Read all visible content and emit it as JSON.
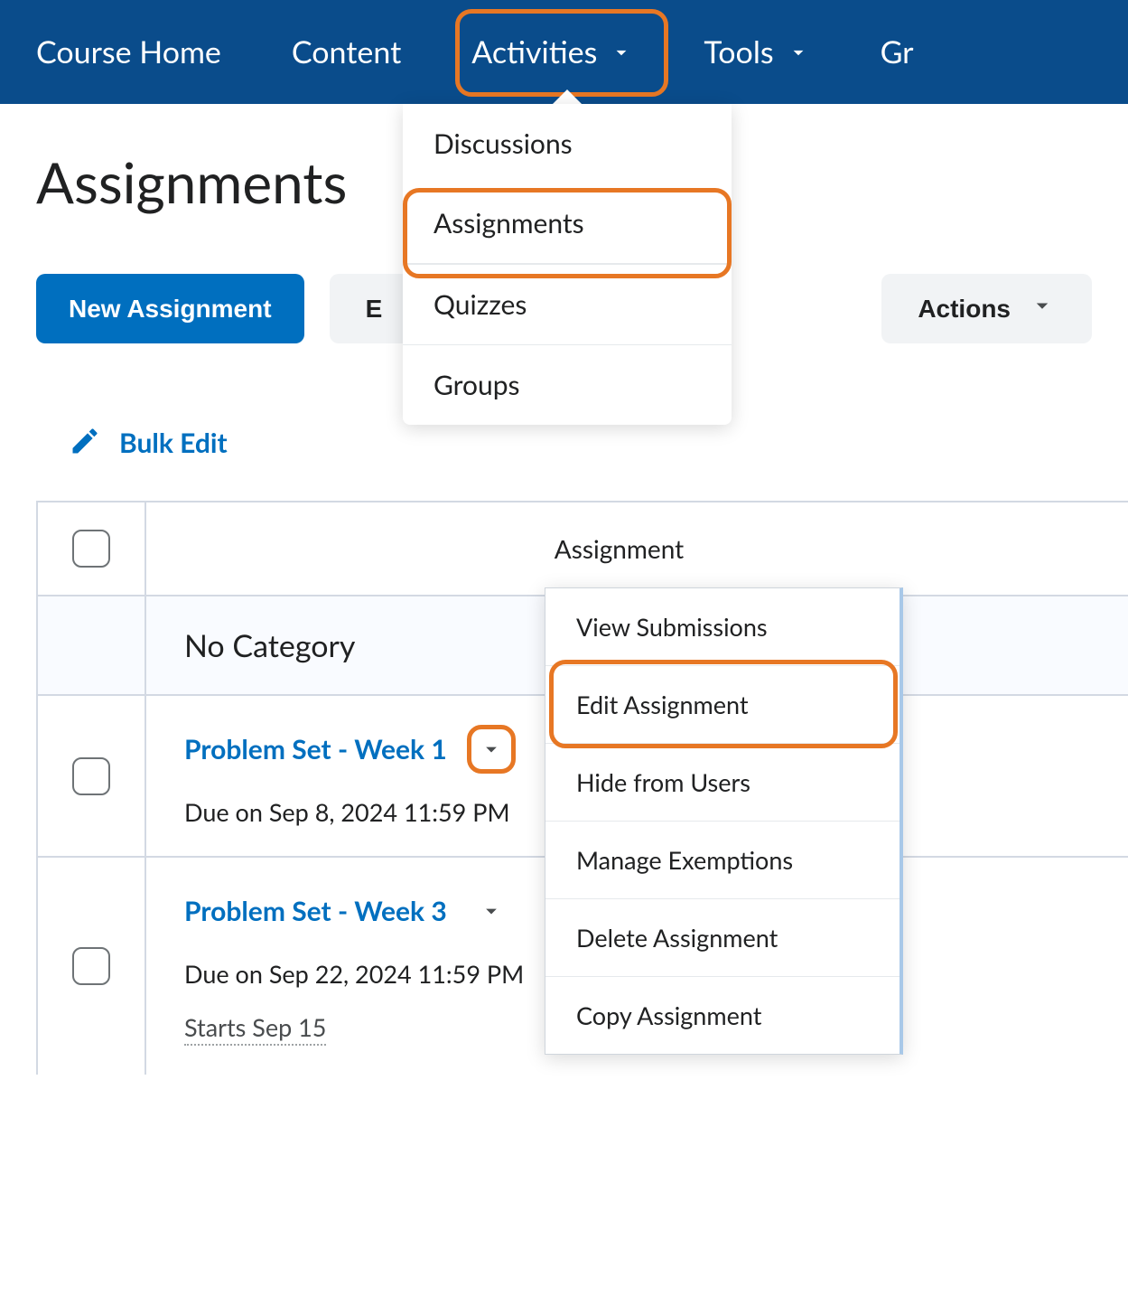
{
  "nav": {
    "course_home": "Course Home",
    "content": "Content",
    "activities": "Activities",
    "tools": "Tools",
    "grades_partial": "Gr"
  },
  "dropdown_activities": {
    "discussions": "Discussions",
    "assignments": "Assignments",
    "quizzes": "Quizzes",
    "groups": "Groups"
  },
  "page_title": "Assignments",
  "toolbar": {
    "new_assignment": "New Assignment",
    "edit_categories_partial": "E",
    "more_actions": "Actions"
  },
  "bulk_edit": "Bulk Edit",
  "table": {
    "col_assignment": "Assignment",
    "no_category": "No Category",
    "rows": [
      {
        "title": "Problem Set - Week 1",
        "due": "Due on Sep 8, 2024 11:59 PM",
        "starts": ""
      },
      {
        "title": "Problem Set - Week 3",
        "due": "Due on Sep 22, 2024 11:59 PM",
        "starts": "Starts Sep 15"
      }
    ]
  },
  "context_menu": {
    "view_submissions": "View Submissions",
    "edit_assignment": "Edit Assignment",
    "hide_from_users": "Hide from Users",
    "manage_exemptions": "Manage Exemptions",
    "delete_assignment": "Delete Assignment",
    "copy_assignment": "Copy Assignment"
  }
}
